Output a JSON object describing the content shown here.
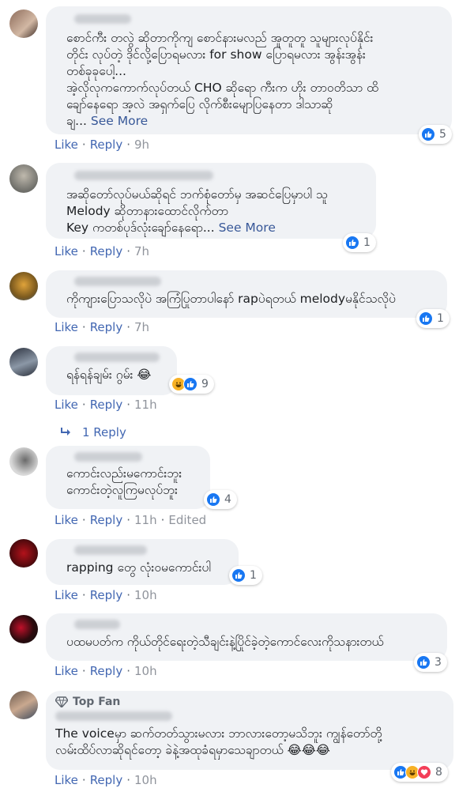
{
  "comments": [
    {
      "lines": [
        "စောင်ကီး တလွဲ ဆိုတာကိုကျ စောင်နားမလည် အူတူတူ သူများလုပ်နိုင်း",
        "တိုင်း လုပ်တဲ့ ဒိုင်လို့ပြောရမလား for show ပြောရမလား အွန်းအွန်း",
        "တစ်ခုခုပေါ့...",
        "အဲ့လိုလုကကောက်လုပ်တယ် CHO ဆိုရော ကီးက ဟိုး တာဝတိသာ ထိ",
        "ချော်နေရော အ့လဲ အရှက်ပြေ လိုက်စီးမျောပြနေတာ ဒါသာဆို",
        "ချ... "
      ],
      "see_more": "See More",
      "like": "Like",
      "reply": "Reply",
      "time": "9h",
      "reaction_count": "5"
    },
    {
      "lines": [
        "အဆိုတော်လုပ်မယ်ဆိုရင် ဘက်စုံတော်မှ အဆင်ပြေမှာပါ သူ",
        "Melody ဆိုတာနားထောင်လိုက်တာ",
        "Key ကတစ်ပုဒ်လုံးချော်နေရော... "
      ],
      "see_more": "See More",
      "like": "Like",
      "reply": "Reply",
      "time": "7h",
      "reaction_count": "1"
    },
    {
      "lines": [
        "ကိုကျားပြောသလိုပဲ အကြံပြုတာပါနော် rapပဲရတယ် melodyမနိုင်သလိုပဲ"
      ],
      "like": "Like",
      "reply": "Reply",
      "time": "7h",
      "reaction_count": "1"
    },
    {
      "lines": [
        "ရန်ရန်ချမ်း ဂွမ်း 😂"
      ],
      "like": "Like",
      "reply": "Reply",
      "time": "11h",
      "reaction_count": "9",
      "replies_link": "1 Reply"
    },
    {
      "lines": [
        "ကောင်းလည်းမကောင်းဘူး",
        "ကောင်းတဲ့လူကြမလုပ်ဘူး"
      ],
      "like": "Like",
      "reply": "Reply",
      "time": "11h",
      "edited": "Edited",
      "reaction_count": "4"
    },
    {
      "lines": [
        "rapping တွေ လုံးဝမကောင်းပါ"
      ],
      "like": "Like",
      "reply": "Reply",
      "time": "10h",
      "reaction_count": "1"
    },
    {
      "lines": [
        "ပထမပတ်က ကိုယ်တိုင်ရေးတဲ့သီချင်းနဲ့ပြိုင်ခဲ့တဲ့ကောင်လေးကိုသနားတယ်"
      ],
      "like": "Like",
      "reply": "Reply",
      "time": "10h",
      "reaction_count": "3"
    },
    {
      "badge": "Top Fan",
      "lines": [
        "The voiceမှာ ဆက်တတ်သွားမလား ဘာလားတော့မသိဘူး ကျွန်တော်တို့",
        "လမ်းထိပ်လာဆိုရင်တော့ ခဲနဲ့အထုခံရမှာသေချာတယ် 😂😂😂"
      ],
      "like": "Like",
      "reply": "Reply",
      "time": "10h",
      "reaction_count": "8"
    }
  ],
  "colors": {
    "link": "#4267b2",
    "bubble": "#f0f2f5",
    "like_blue": "#1877f2"
  }
}
